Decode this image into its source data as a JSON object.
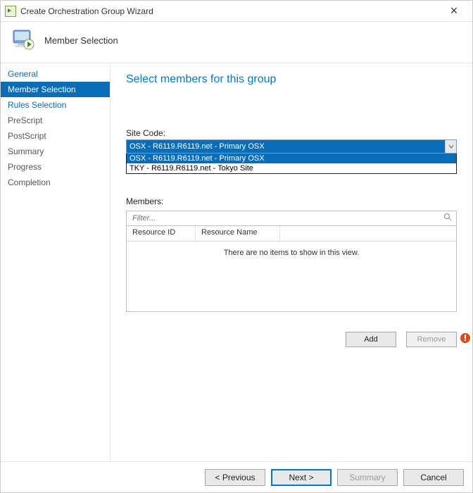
{
  "window": {
    "title": "Create Orchestration Group Wizard"
  },
  "header": {
    "heading": "Member Selection"
  },
  "sidebar": {
    "items": [
      {
        "label": "General"
      },
      {
        "label": "Member Selection"
      },
      {
        "label": "Rules Selection"
      },
      {
        "label": "PreScript"
      },
      {
        "label": "PostScript"
      },
      {
        "label": "Summary"
      },
      {
        "label": "Progress"
      },
      {
        "label": "Completion"
      }
    ],
    "selectedIndex": 1
  },
  "main": {
    "title": "Select members for this group",
    "siteCodeLabel": "Site Code:",
    "siteCodeValue": "OSX - R6119.R6119.net - Primary OSX",
    "siteCodeOptions": [
      "OSX - R6119.R6119.net - Primary OSX",
      "TKY - R6119.R6119.net - Tokyo Site"
    ],
    "membersLabel": "Members:",
    "filterPlaceholder": "Filter...",
    "columns": {
      "c1": "Resource ID",
      "c2": "Resource Name"
    },
    "emptyText": "There are no items to show in this view.",
    "addLabel": "Add",
    "removeLabel": "Remove"
  },
  "footer": {
    "previous": "< Previous",
    "next": "Next >",
    "summary": "Summary",
    "cancel": "Cancel"
  }
}
